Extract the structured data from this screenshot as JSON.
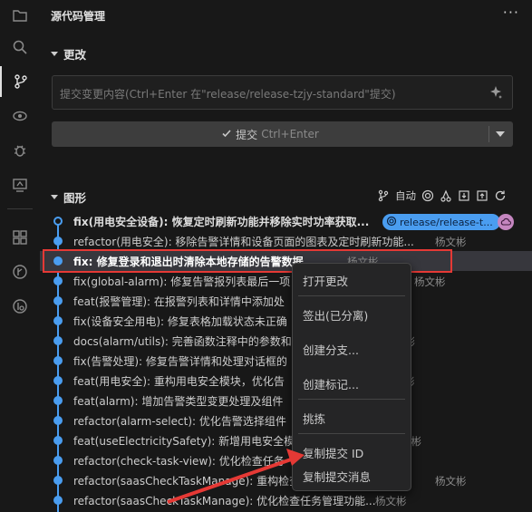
{
  "panel": {
    "title": "源代码管理",
    "more_label": "···"
  },
  "changes": {
    "section_label": "更改",
    "message_placeholder": "提交变更内容(Ctrl+Enter 在\"release/release-tzjy-standard\"提交)",
    "commit_label": "提交",
    "commit_shortcut": "Ctrl+Enter"
  },
  "graph": {
    "section_label": "图形",
    "auto_label": "自动",
    "branch_tag": "release/release-t...",
    "commits": [
      {
        "message": "fix(用电安全设备): 恢复定时刷新功能并移除实时功率获取...",
        "author": ""
      },
      {
        "message": "refactor(用电安全): 移除告警详情和设备页面的图表及定时刷新功能...",
        "author": "杨文彬"
      },
      {
        "message": "fix: 修复登录和退出时清除本地存储的告警数据",
        "author": "杨文彬"
      },
      {
        "message": "fix(global-alarm): 修复告警报列表最后一项",
        "author": "杨文彬"
      },
      {
        "message": "feat(报警管理): 在报警列表和详情中添加处",
        "author": ""
      },
      {
        "message": "fix(设备安全用电): 修复表格加载状态未正确",
        "author": ""
      },
      {
        "message": "docs(alarm/utils): 完善函数注释中的参数和",
        "author": "文彬"
      },
      {
        "message": "fix(告警处理): 修复告警详情和处理对话框的",
        "author": ""
      },
      {
        "message": "feat(用电安全): 重构用电安全模块，优化告",
        "author": "杨文彬"
      },
      {
        "message": "feat(alarm): 增加告警类型变更处理及组件",
        "author": ""
      },
      {
        "message": "refactor(alarm-select): 优化告警选择组件",
        "author": ""
      },
      {
        "message": "feat(useElectricitySafety): 新增用电安全模",
        "author": "文彬"
      },
      {
        "message": "refactor(check-task-view): 优化检查任务",
        "author": ""
      },
      {
        "message": "refactor(saasCheckTaskManage): 重构检查",
        "author": "杨文彬"
      },
      {
        "message": "refactor(saasCheckTaskManage): 优化检查任务管理功能...",
        "author": "杨文彬"
      }
    ]
  },
  "context_menu": {
    "items": [
      "打开更改",
      "签出(已分离)",
      "创建分支...",
      "创建标记...",
      "挑拣",
      "复制提交 ID",
      "复制提交消息"
    ]
  }
}
